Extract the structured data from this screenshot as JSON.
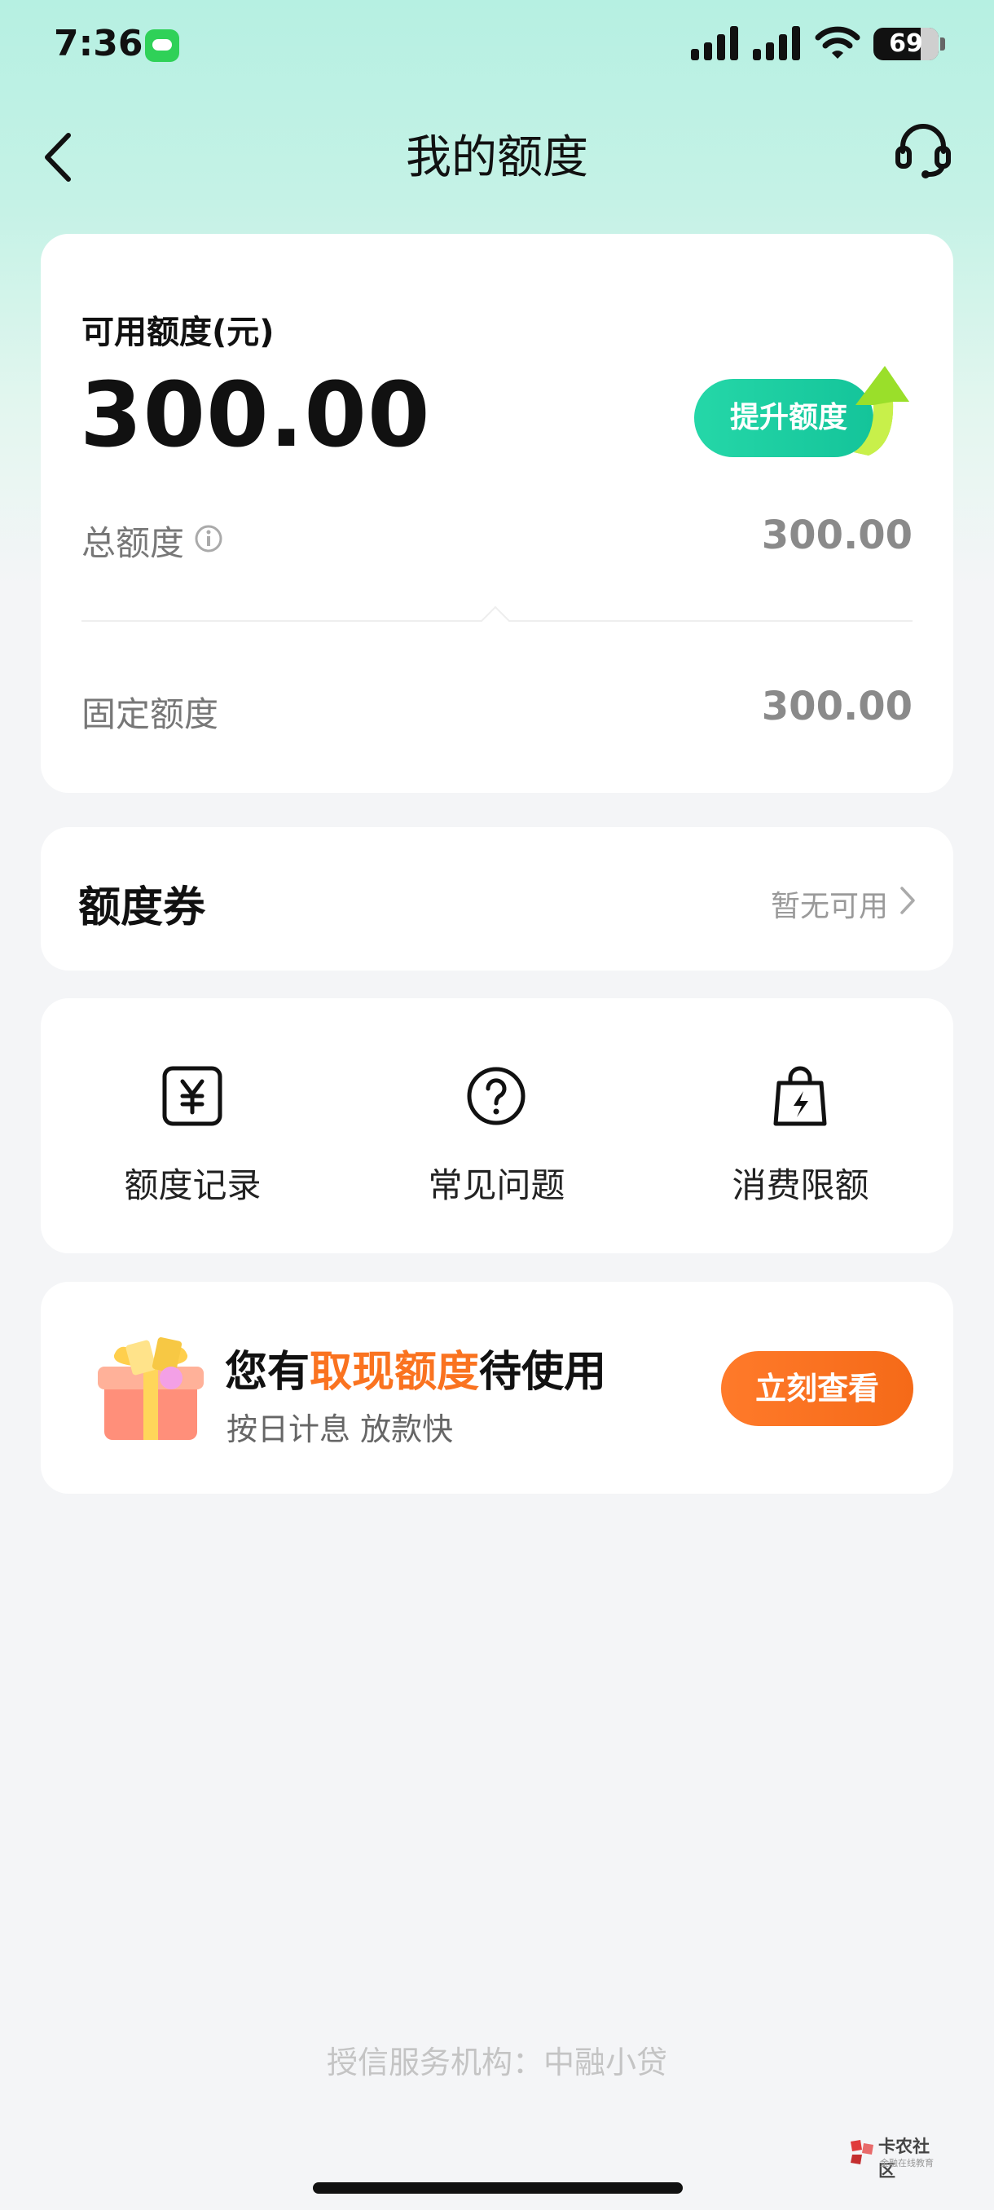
{
  "status_bar": {
    "time": "7:36",
    "battery": "69"
  },
  "nav": {
    "title": "我的额度"
  },
  "credit": {
    "available_label": "可用额度(元)",
    "available_amount": "300.00",
    "upgrade_button": "提升额度",
    "total_label": "总额度",
    "total_value": "300.00",
    "fixed_label": "固定额度",
    "fixed_value": "300.00"
  },
  "coupon": {
    "title": "额度券",
    "status": "暂无可用"
  },
  "shortcuts": [
    {
      "label": "额度记录",
      "icon": "yuan-record-icon"
    },
    {
      "label": "常见问题",
      "icon": "question-icon"
    },
    {
      "label": "消费限额",
      "icon": "shopping-bag-lightning-icon"
    }
  ],
  "promo": {
    "title_prefix": "您有",
    "title_highlight": "取现额度",
    "title_suffix": "待使用",
    "subtitle": "按日计息 放款快",
    "button": "立刻查看"
  },
  "footer": {
    "text": "授信服务机构：中融小贷"
  },
  "watermark": {
    "title": "卡农社区",
    "subtitle": "金融在线教育"
  },
  "colors": {
    "accent_green": "#14c49a",
    "accent_orange": "#fa7320",
    "header_mint": "#b6f0e2"
  }
}
